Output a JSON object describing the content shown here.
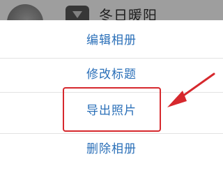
{
  "background": {
    "album_name": "冬日暖阳"
  },
  "menu": {
    "items": [
      {
        "label": "编辑相册"
      },
      {
        "label": "修改标题"
      },
      {
        "label": "导出照片"
      },
      {
        "label": "删除相册"
      }
    ]
  },
  "colors": {
    "menu_text": "#2a6fb8",
    "highlight": "#d6282d"
  }
}
